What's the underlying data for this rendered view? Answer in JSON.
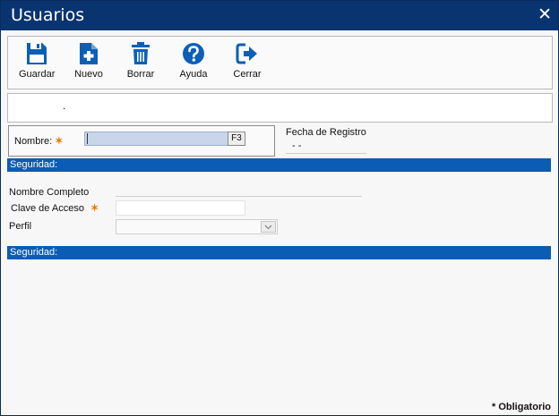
{
  "window": {
    "title": "Usuarios",
    "close_glyph": "✕"
  },
  "toolbar": {
    "buttons": [
      {
        "label": "Guardar",
        "icon": "floppy-disk-icon"
      },
      {
        "label": "Nuevo",
        "icon": "new-document-icon"
      },
      {
        "label": "Borrar",
        "icon": "trash-icon"
      },
      {
        "label": "Ayuda",
        "icon": "help-icon"
      },
      {
        "label": "Cerrar",
        "icon": "exit-icon"
      }
    ]
  },
  "info": {
    "text": "."
  },
  "form": {
    "nombre_label": "Nombre:",
    "required_mark": "✶",
    "nombre_value": "",
    "f3_label": "F3",
    "fecha_label": "Fecha de Registro",
    "fecha_value": "- -"
  },
  "sections": {
    "seguridad_1": "Seguridad:",
    "seguridad_2": "Seguridad:"
  },
  "security": {
    "nombre_completo_label": "Nombre Completo",
    "clave_label": "Clave de Acceso",
    "perfil_label": "Perfil"
  },
  "footer": {
    "obligatorio": "* Obligatorio"
  },
  "colors": {
    "title_bar": "#0a3470",
    "section_bar": "#0a5cb5",
    "icon_blue": "#0b5fb7",
    "required": "#f07800"
  }
}
